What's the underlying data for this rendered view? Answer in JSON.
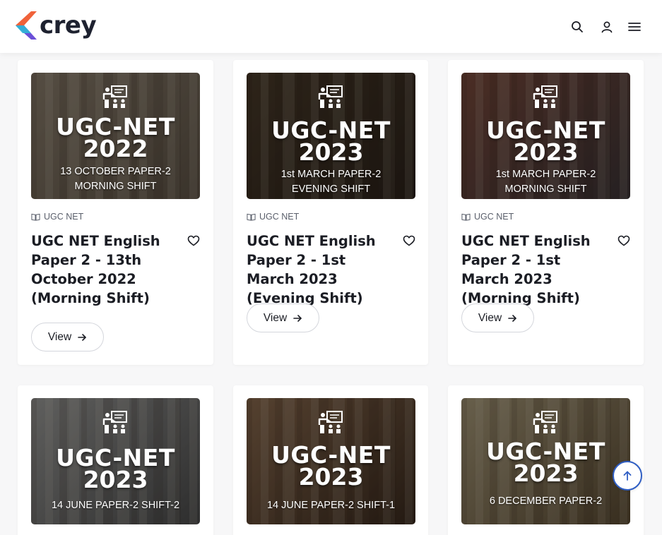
{
  "header": {
    "logo_text": "crey",
    "icons": [
      "search-icon",
      "user-icon",
      "menu-icon"
    ]
  },
  "cards": [
    {
      "exam": "UGC-NET",
      "year": "2022",
      "sub1": "13 OCTOBER PAPER-2",
      "sub2": "MORNING SHIFT",
      "category": "UGC NET",
      "title": "UGC NET English Paper 2 - 13th October 2022 (Morning Shift)",
      "view": "View",
      "bg": "#8a7d6c",
      "bg2": "#5e5346"
    },
    {
      "exam": "UGC-NET",
      "year": "2023",
      "sub1": "1st MARCH PAPER-2",
      "sub2": "EVENING SHIFT",
      "category": "UGC NET",
      "title": "UGC NET English Paper 2 - 1st March 2023 (Evening Shift)",
      "view": "View",
      "bg": "#4a3b2a",
      "bg2": "#2c221a"
    },
    {
      "exam": "UGC-NET",
      "year": "2023",
      "sub1": "1st MARCH PAPER-2",
      "sub2": "MORNING SHIFT",
      "category": "UGC NET",
      "title": "UGC NET English Paper 2 - 1st March 2023 (Morning Shift)",
      "view": "View",
      "bg": "#7a4a3c",
      "bg2": "#3c3436"
    },
    {
      "exam": "UGC-NET",
      "year": "2023",
      "sub1": "14 JUNE PAPER-2 SHIFT-2",
      "sub2": "",
      "bg": "#9a9a98",
      "bg2": "#4a4a4a"
    },
    {
      "exam": "UGC-NET",
      "year": "2023",
      "sub1": "14 JUNE PAPER-2  SHIFT-1",
      "sub2": "",
      "bg": "#8a6a4e",
      "bg2": "#3a2a1e"
    },
    {
      "exam": "UGC-NET",
      "year": "2023",
      "sub1": "6 DECEMBER PAPER-2",
      "sub2": "",
      "bg": "#a89a7a",
      "bg2": "#5a4a32"
    }
  ],
  "scroll_top": {
    "icon": "arrow-up-icon"
  },
  "colors": {
    "accent": "#2f5ec4",
    "text": "#1b1d24"
  }
}
